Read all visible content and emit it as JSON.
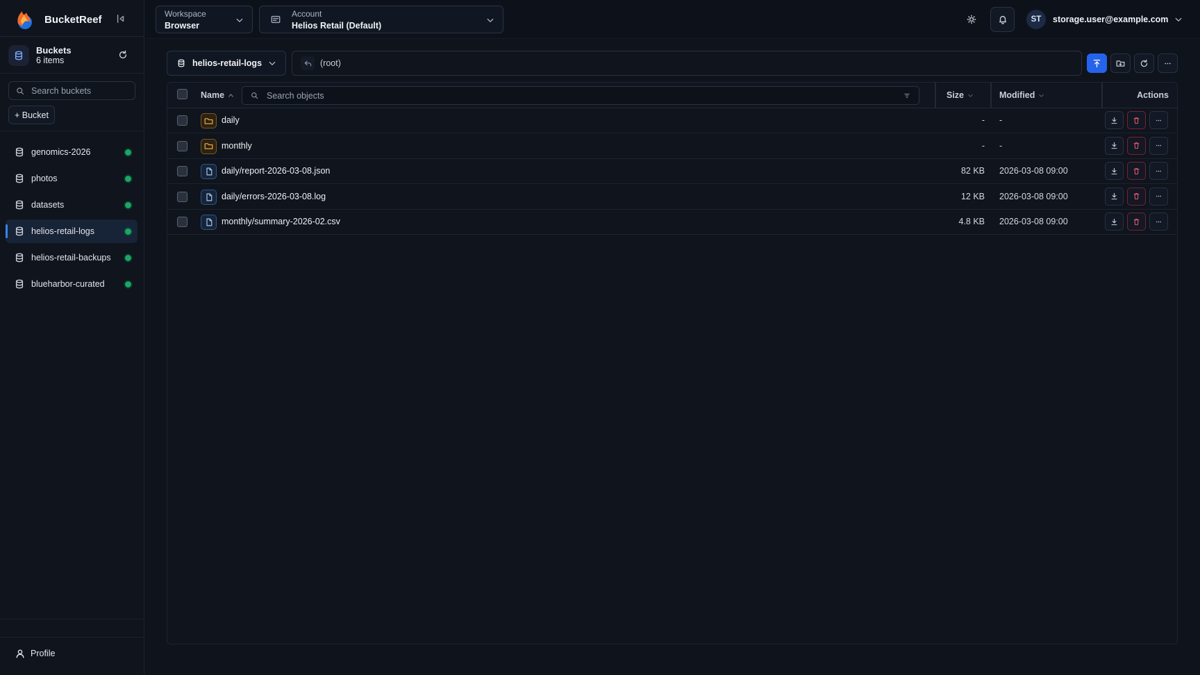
{
  "app": {
    "name": "BucketReef"
  },
  "sidebar": {
    "buckets_title": "Buckets",
    "buckets_count": "6 items",
    "search_placeholder": "Search buckets",
    "add_bucket_label": "+ Bucket",
    "items": [
      {
        "label": "genomics-2026",
        "status": "online",
        "active": false
      },
      {
        "label": "photos",
        "status": "online",
        "active": false
      },
      {
        "label": "datasets",
        "status": "online",
        "active": false
      },
      {
        "label": "helios-retail-logs",
        "status": "online",
        "active": true
      },
      {
        "label": "helios-retail-backups",
        "status": "online",
        "active": false
      },
      {
        "label": "blueharbor-curated",
        "status": "online",
        "active": false
      }
    ],
    "profile_label": "Profile"
  },
  "topbar": {
    "workspace_key": "Workspace",
    "workspace_value": "Browser",
    "account_key": "Account",
    "account_value": "Helios Retail (Default)",
    "user_initials": "ST",
    "user_email": "storage.user@example.com"
  },
  "toolbar": {
    "bucket": "helios-retail-logs",
    "path": "(root)"
  },
  "table": {
    "col_name": "Name",
    "col_size": "Size",
    "col_modified": "Modified",
    "col_actions": "Actions",
    "search_placeholder": "Search objects",
    "rows": [
      {
        "type": "folder",
        "name": "daily",
        "size": "-",
        "modified": "-"
      },
      {
        "type": "folder",
        "name": "monthly",
        "size": "-",
        "modified": "-"
      },
      {
        "type": "file",
        "name": "daily/report-2026-03-08.json",
        "size": "82 KB",
        "modified": "2026-03-08 09:00"
      },
      {
        "type": "file",
        "name": "daily/errors-2026-03-08.log",
        "size": "12 KB",
        "modified": "2026-03-08 09:00"
      },
      {
        "type": "file",
        "name": "monthly/summary-2026-02.csv",
        "size": "4.8 KB",
        "modified": "2026-03-08 09:00"
      }
    ]
  },
  "colors": {
    "accent": "#2563eb",
    "status_online": "#18a864",
    "danger": "#e0566a",
    "folder": "#e8a63a"
  }
}
